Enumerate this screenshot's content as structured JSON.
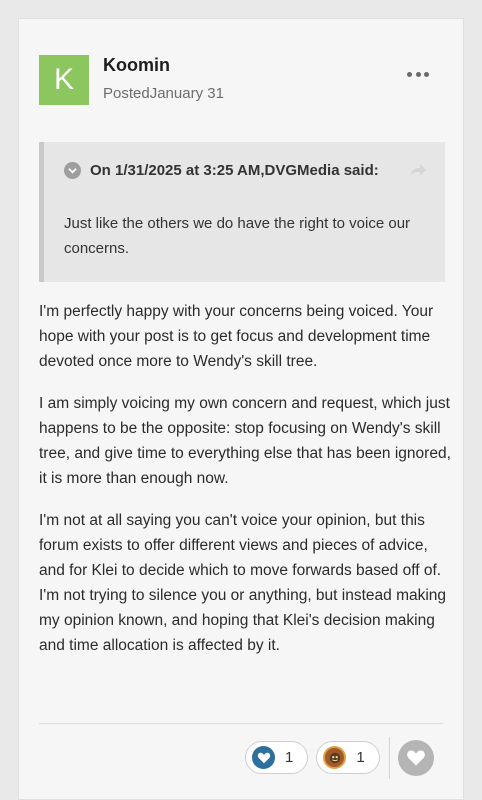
{
  "author": {
    "initial": "K",
    "name": "Koomin",
    "posted": "PostedJanuary 31",
    "avatar_color": "#8cc65e"
  },
  "quote": {
    "cite": "On 1/31/2025 at 3:25 AM,DVGMedia said:",
    "text": "Just like the others we do have the right to voice our concerns."
  },
  "post": {
    "paragraphs": [
      "I'm perfectly happy with your concerns being voiced.  Your hope with your post is to get focus and development time devoted once more to Wendy's skill tree.",
      "I am simply voicing my own concern and request, which just happens to be the opposite: stop focusing on Wendy's skill tree, and give time to everything else that has been ignored, it is more than enough now.",
      "I'm not at all saying you can't voice your opinion, but this forum exists to offer different views and pieces of advice, and for Klei to decide which to move forwards based off of.  I'm not trying to silence you or anything, but instead making my opinion known, and hoping that Klei's decision making and time allocation is affected by it."
    ]
  },
  "reactions": [
    {
      "icon": "heart-reaction-icon",
      "count": "1"
    },
    {
      "icon": "face-reaction-icon",
      "count": "1"
    }
  ],
  "icons": {
    "more": "more-options-icon",
    "toggle": "chevron-down-icon",
    "share": "share-arrow-icon",
    "like": "heart-icon"
  }
}
